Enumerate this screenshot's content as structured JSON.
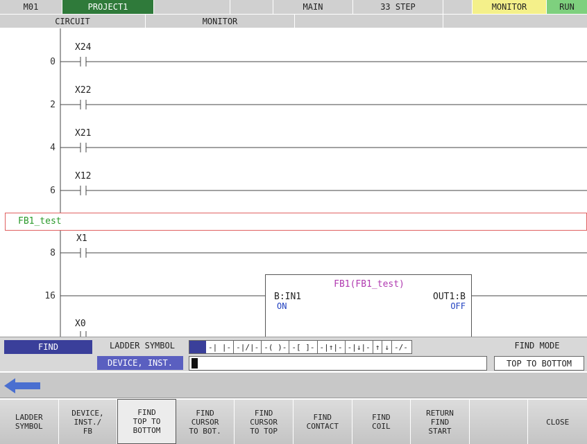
{
  "header": {
    "machine": "M01",
    "project": "PROJECT1",
    "blank1": "",
    "program": "MAIN",
    "steps": "33 STEP",
    "blank2": "",
    "mode": "MONITOR",
    "status": "RUN"
  },
  "subheader": {
    "circuit": "CIRCUIT",
    "monitor": "MONITOR"
  },
  "ladder": {
    "rungs": [
      {
        "step": "0",
        "device": "X24"
      },
      {
        "step": "2",
        "device": "X22"
      },
      {
        "step": "4",
        "device": "X21"
      },
      {
        "step": "6",
        "device": "X12"
      },
      {
        "step": "8",
        "device": "X1"
      }
    ],
    "fb_bar_label": "FB1_test",
    "fb_step": "16",
    "fb_title": "FB1(FB1_test)",
    "fb_input": "B:IN1",
    "fb_input_state": "ON",
    "fb_output": "OUT1:B",
    "fb_output_state": "OFF",
    "fb_next_device": "X0",
    "colors": {
      "fb_title": "#b03ab0",
      "fb_label": "#2a9a2a",
      "state": "#2040c0",
      "fb_bar_border": "#e06060"
    }
  },
  "find": {
    "find_label": "FIND",
    "ladder_symbol_label": "LADDER SYMBOL",
    "device_inst_label": "DEVICE, INST.",
    "device_input_value": "",
    "find_mode_label": "FIND MODE",
    "find_mode_value": "TOP TO BOTTOM",
    "symbols": [
      "-| |-",
      "-|/|-",
      "-( )-",
      "-[ ]-",
      "-|↑|-",
      "-|↓|-",
      "↑",
      "↓",
      "-/-"
    ]
  },
  "back": {
    "icon": "back-arrow-icon"
  },
  "function_keys": [
    {
      "label": "LADDER\nSYMBOL",
      "active": false
    },
    {
      "label": "DEVICE,\nINST./\nFB",
      "active": false
    },
    {
      "label": "FIND\nTOP TO\nBOTTOM",
      "active": true
    },
    {
      "label": "FIND\nCURSOR\nTO BOT.",
      "active": false
    },
    {
      "label": "FIND\nCURSOR\nTO TOP",
      "active": false
    },
    {
      "label": "FIND\nCONTACT",
      "active": false
    },
    {
      "label": "FIND\nCOIL",
      "active": false
    },
    {
      "label": "RETURN\nFIND\nSTART",
      "active": false
    },
    {
      "label": "",
      "active": false
    },
    {
      "label": "CLOSE",
      "active": false
    }
  ]
}
